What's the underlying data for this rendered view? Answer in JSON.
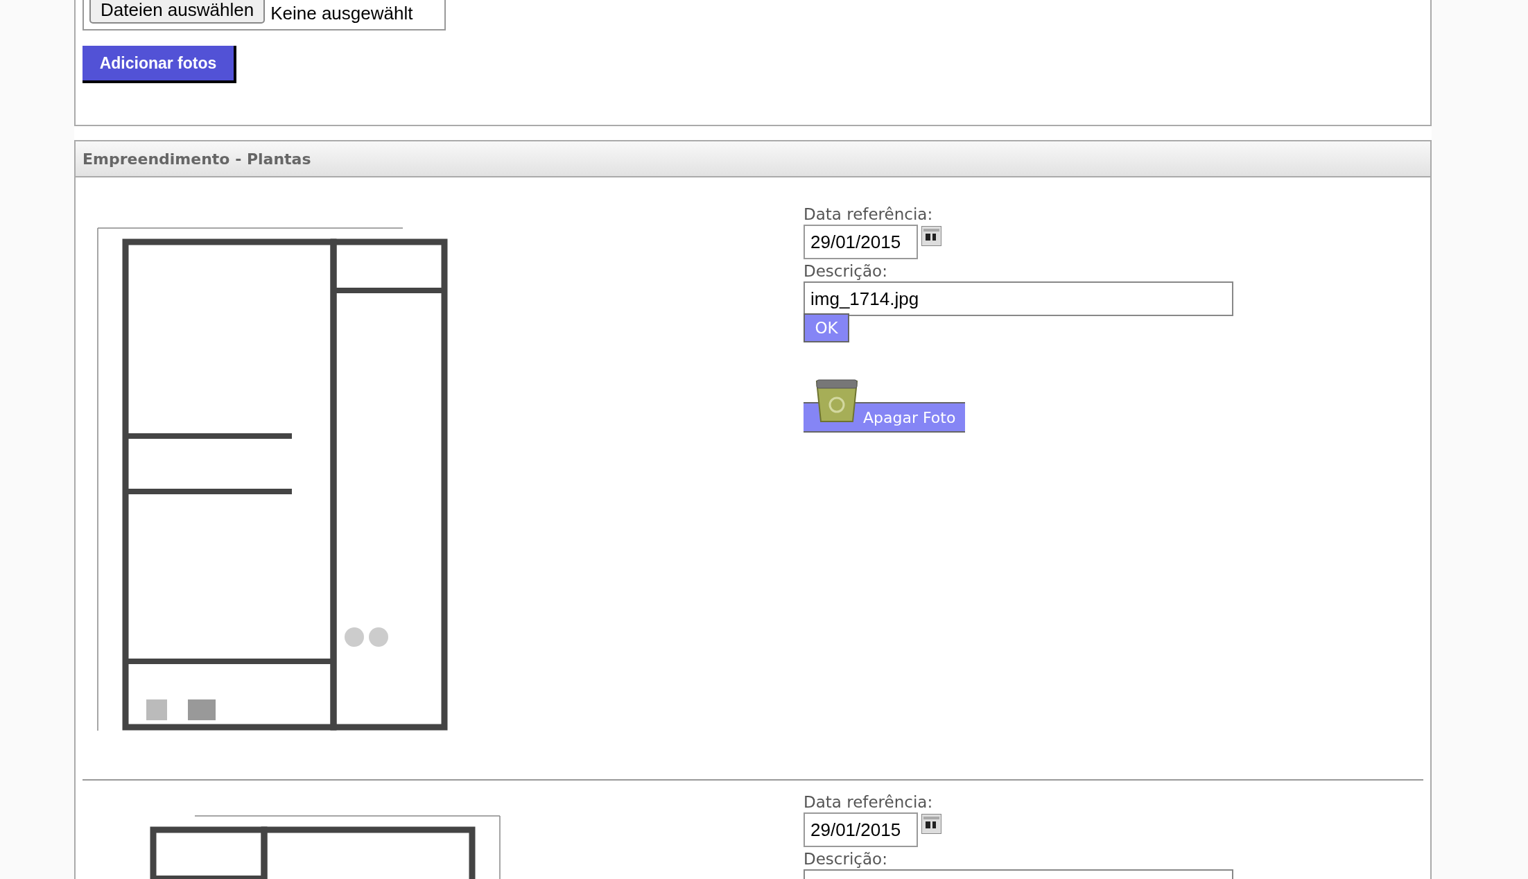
{
  "upload": {
    "file_button": "Dateien auswählen",
    "file_status": "Keine ausgewählt",
    "submit": "Adicionar fotos"
  },
  "section": {
    "title": "Empreendimento - Plantas",
    "photos": [
      {
        "kind": "picture",
        "date_label": "Data referência:",
        "date": "29/01/2015",
        "description_label": "Descrição:",
        "description": "img_1714.jpg",
        "ok": "OK",
        "delete": "Apagar Foto"
      },
      {
        "kind": "picture",
        "date_label": "Data referência:",
        "date": "29/01/2015",
        "description_label": "Descrição:"
      }
    ]
  }
}
